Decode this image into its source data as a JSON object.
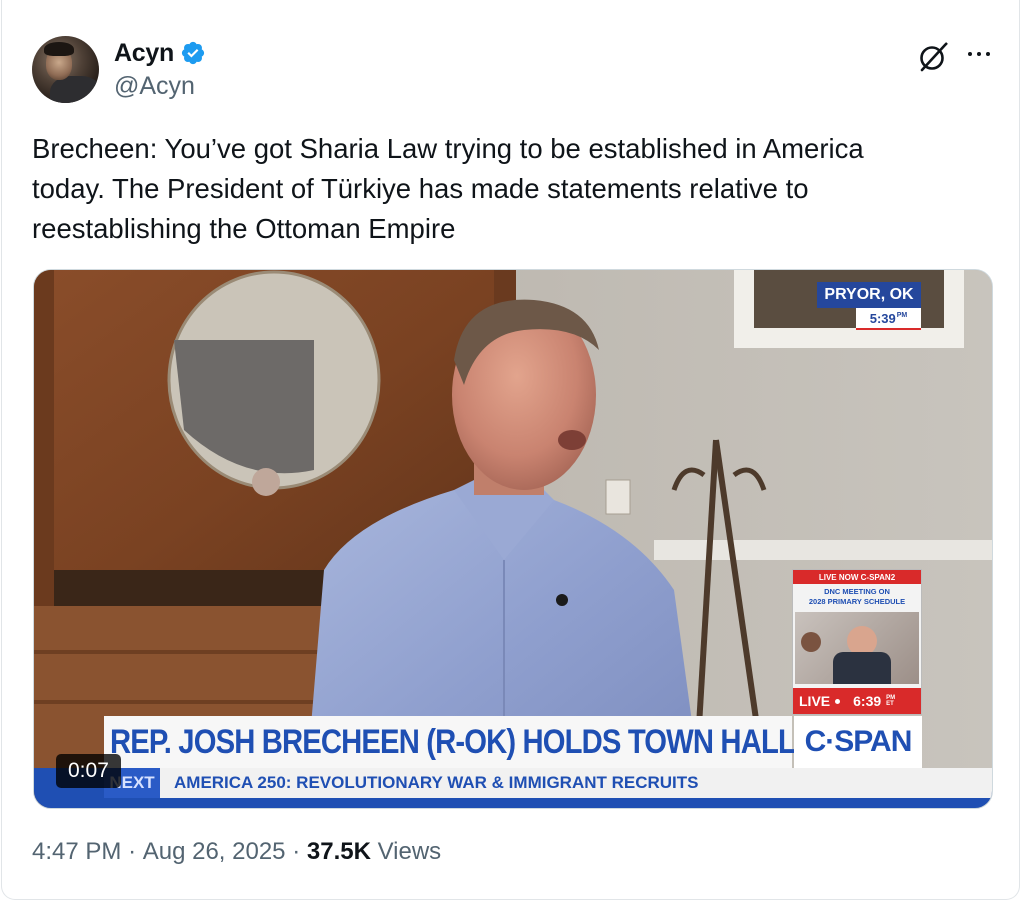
{
  "post": {
    "author": {
      "display_name": "Acyn",
      "handle": "@Acyn",
      "verified": true
    },
    "text_lines": [
      "Brecheen: You’ve got Sharia Law trying to be established in America",
      "today. The President of Türkiye has made statements relative to",
      "reestablishing the Ottoman Empire"
    ],
    "timestamp": "4:47 PM",
    "date": "Aug 26, 2025",
    "views_count": "37.5K",
    "views_label": "Views",
    "separator": "·",
    "actions": {
      "grok_icon": "grok-icon",
      "more_icon": "more-options-icon"
    }
  },
  "video": {
    "duration": "0:07",
    "location_bug": "PRYOR, OK",
    "time_bug": "5:39",
    "time_bug_suffix": "PM",
    "pip_header": "LIVE NOW C-SPAN2",
    "pip_line1": "DNC MEETING ON",
    "pip_line2": "2028 PRIMARY SCHEDULE",
    "pip_live": "LIVE",
    "pip_time": "6:39",
    "pip_time_suffix": "PM ET",
    "lower_third": "REP. JOSH BRECHEEN (R-OK) HOLDS TOWN HALL",
    "network": "C·SPAN",
    "next_label": "NEXT",
    "next_title": "AMERICA 250: REVOLUTIONARY WAR & IMMIGRANT RECRUITS"
  },
  "colors": {
    "verified_blue": "#1d9bf0",
    "cspan_blue": "#1f4fb3",
    "live_red": "#d92a2a",
    "secondary_text": "#536471",
    "primary_text": "#0f1419"
  }
}
